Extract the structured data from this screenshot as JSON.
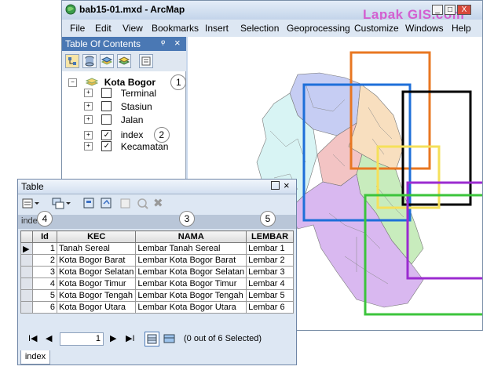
{
  "window": {
    "title": "bab15-01.mxd - ArcMap",
    "watermark": "Lapak GIS.com",
    "controls": [
      "_",
      "□",
      "X"
    ]
  },
  "menubar": [
    "File",
    "Edit",
    "View",
    "Bookmarks",
    "Insert",
    "Selection",
    "Geoprocessing",
    "Customize",
    "Windows",
    "Help"
  ],
  "toc": {
    "title": "Table Of Contents",
    "pin": "ᵠ",
    "close": "×",
    "group": {
      "label": "Kota Bogor",
      "callout": "1"
    },
    "layers": [
      {
        "label": "Terminal",
        "checked": false
      },
      {
        "label": "Stasiun",
        "checked": false
      },
      {
        "label": "Jalan",
        "checked": false
      },
      {
        "label": "index",
        "checked": true,
        "callout": "2"
      },
      {
        "label": "Kecamatan",
        "checked": true
      }
    ]
  },
  "table_window": {
    "title": "Table",
    "tab_name": "index",
    "callouts": [
      "4",
      "3",
      "5"
    ],
    "columns": [
      "",
      "Id",
      "KEC",
      "NAMA",
      "LEMBAR"
    ],
    "rows": [
      {
        "sel": "▶",
        "id": "1",
        "kec": "Tanah Sereal",
        "nama": "Lembar Tanah Sereal",
        "lembar": "Lembar 1"
      },
      {
        "sel": "",
        "id": "2",
        "kec": "Kota Bogor Barat",
        "nama": "Lembar Kota Bogor Barat",
        "lembar": "Lembar 2"
      },
      {
        "sel": "",
        "id": "3",
        "kec": "Kota Bogor Selatan",
        "nama": "Lembar Kota Bogor Selatan",
        "lembar": "Lembar 3"
      },
      {
        "sel": "",
        "id": "4",
        "kec": "Kota Bogor Timur",
        "nama": "Lembar Kota Bogor Timur",
        "lembar": "Lembar 4"
      },
      {
        "sel": "",
        "id": "5",
        "kec": "Kota Bogor Tengah",
        "nama": "Lembar Kota Bogor Tengah",
        "lembar": "Lembar 5"
      },
      {
        "sel": "",
        "id": "6",
        "kec": "Kota Bogor Utara",
        "nama": "Lembar Kota Bogor Utara",
        "lembar": "Lembar 6"
      }
    ],
    "nav": {
      "first": "I◀",
      "prev": "◀",
      "record": "1",
      "next": "▶",
      "last": "▶I",
      "status": "(0 out of 6 Selected)"
    },
    "bottom_tab": "index"
  },
  "colors": {
    "index_frames": [
      "#e87722",
      "#1e6fd9",
      "#000000",
      "#f5e05a",
      "#9b2bd0",
      "#3cc43c"
    ],
    "accent": "#4a78b4",
    "watermark": "#d35fd0"
  }
}
